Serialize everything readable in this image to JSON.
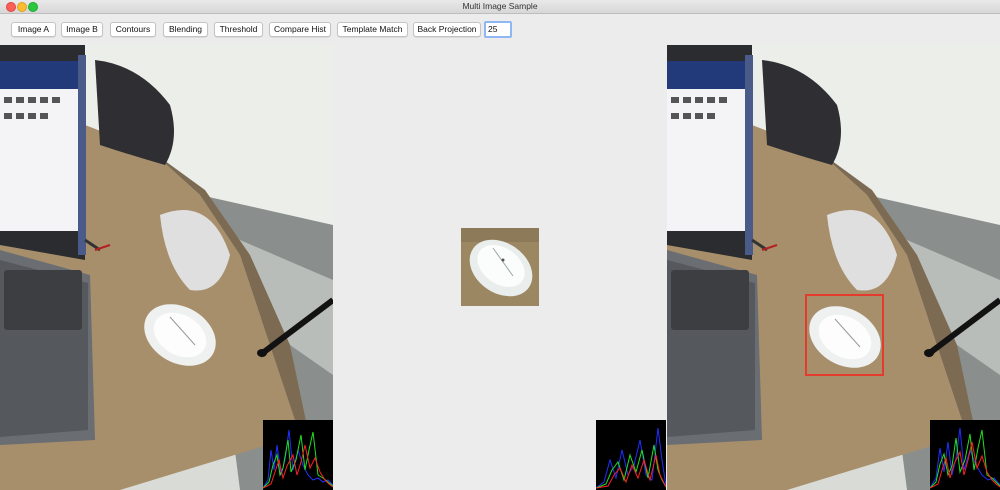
{
  "window": {
    "title": "Multi Image Sample"
  },
  "toolbar": {
    "buttons": [
      "Image A",
      "Image B",
      "Contours",
      "Blending",
      "Threshold",
      "Compare Hist",
      "Template Match",
      "Back Projection"
    ],
    "threshold_value": "25"
  },
  "colors": {
    "match_rect": "#e53a2e",
    "focus_ring": "#8fb7f4"
  }
}
